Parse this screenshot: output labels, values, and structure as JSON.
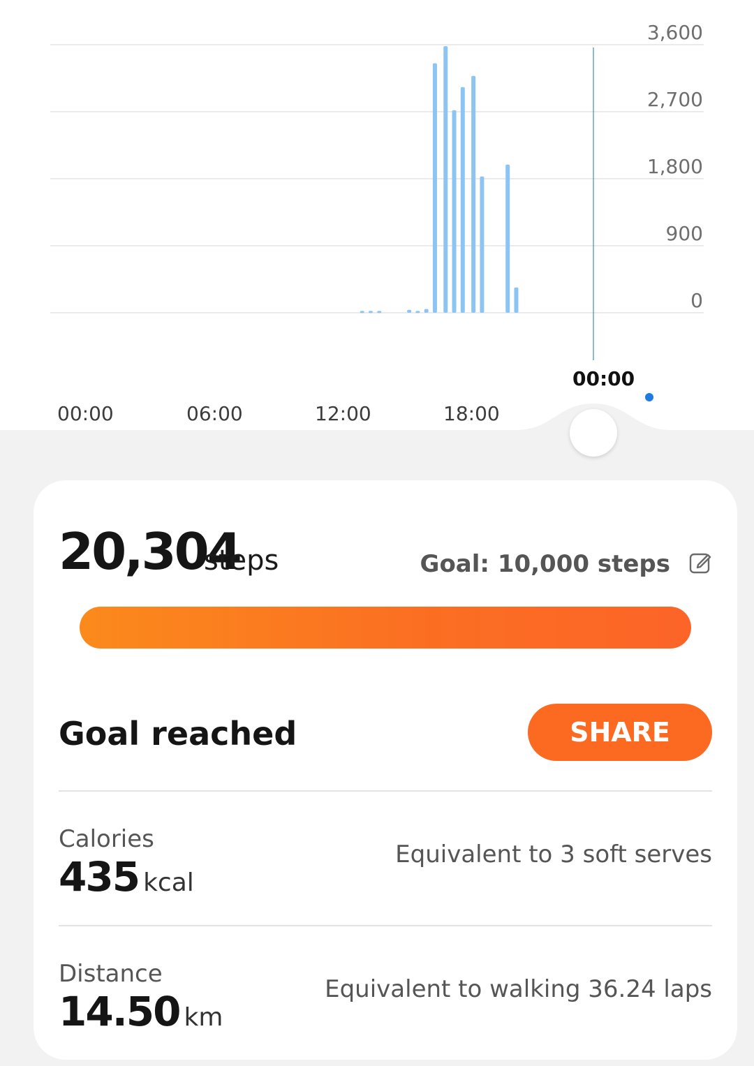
{
  "chart": {
    "y_ticks": [
      "3,600",
      "2,700",
      "1,800",
      "900",
      "0"
    ],
    "x_ticks": [
      "00:00",
      "06:00",
      "12:00",
      "18:00"
    ],
    "cursor_label": "00:00"
  },
  "chart_data": {
    "type": "bar",
    "xlabel": "",
    "ylabel": "",
    "ylim": [
      0,
      3600
    ],
    "x_range_hours": [
      0,
      24
    ],
    "x_hours": [
      13.0,
      13.4,
      13.8,
      15.2,
      15.6,
      16.0,
      16.4,
      16.9,
      17.3,
      17.7,
      18.2,
      18.6,
      19.8,
      20.2
    ],
    "values": [
      25,
      25,
      25,
      40,
      25,
      50,
      3350,
      3580,
      2720,
      3030,
      3180,
      1830,
      1990,
      340
    ],
    "grid": true,
    "color": "#8cc4f3"
  },
  "summary": {
    "steps_value": "20,304",
    "steps_unit": "steps",
    "goal_text": "Goal: 10,000 steps",
    "progress_fraction": 1.0,
    "goal_status": "Goal reached",
    "share_label": "SHARE"
  },
  "calories": {
    "title": "Calories",
    "value": "435",
    "unit": "kcal",
    "equivalent": "Equivalent to 3 soft serves"
  },
  "distance": {
    "title": "Distance",
    "value": "14.50",
    "unit": "km",
    "equivalent": "Equivalent to walking 36.24 laps"
  },
  "colors": {
    "accent": "#fc6a22",
    "bar": "#8cc4f3",
    "cursor_dot": "#1e7be0"
  }
}
